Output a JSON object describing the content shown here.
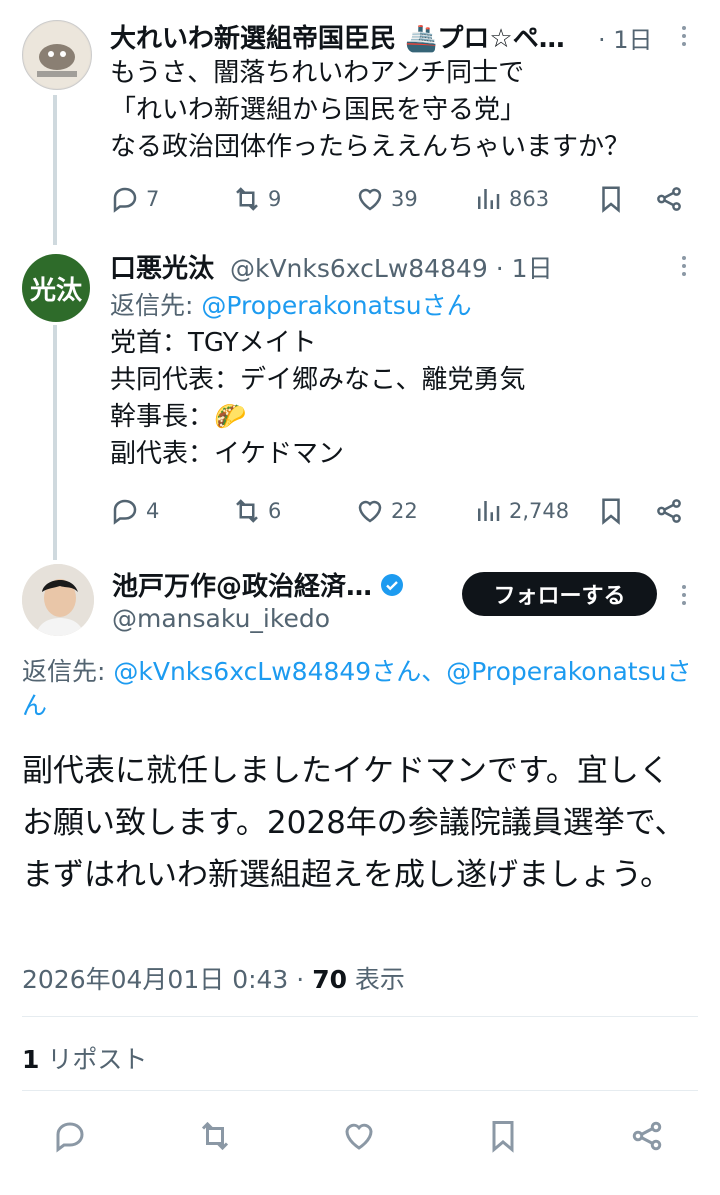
{
  "reply1": {
    "name": "大れいわ新選組帝国臣民 🚢プロ☆ペ…",
    "time": "· 1日",
    "text": "もうさ、闇落ちれいわアンチ同士で\n「れいわ新選組から国民を守る党」\nなる政治団体作ったらええんちゃいますか？",
    "replies": "7",
    "reposts": "9",
    "likes": "39",
    "views": "863"
  },
  "reply2": {
    "avatar_text": "光汰",
    "name": "口悪光汰",
    "handle": "@kVnks6xcLw84849",
    "time": "· 1日",
    "reply_to_label": "返信先: ",
    "reply_to_user": "@Properakonatsuさん",
    "text": "党首：TGYメイト\n共同代表：デイ郷みなこ、離党勇気\n幹事長：🌮\n副代表：イケドマン",
    "replies": "4",
    "reposts": "6",
    "likes": "22",
    "views": "2,748"
  },
  "main": {
    "name": "池戸万作@政治経済…",
    "handle": "@mansaku_ikedo",
    "follow_label": "フォローする",
    "reply_to_label": "返信先: ",
    "reply_to_users": "@kVnks6xcLw84849さん、@Properakonatsuさん",
    "text": "副代表に就任しましたイケドマンです。宜しくお願い致します。2028年の参議院議員選挙で、まずはれいわ新選組超えを成し遂げましょう。",
    "timestamp": "2026年04月01日 0:43 · ",
    "views_count": "70",
    "views_label": " 表示",
    "repost_count": "1",
    "repost_label": " リポスト"
  },
  "colors": {
    "accent": "#1d9bf0",
    "follow_bg": "#0f1419",
    "verified": "#1d9bf0"
  }
}
